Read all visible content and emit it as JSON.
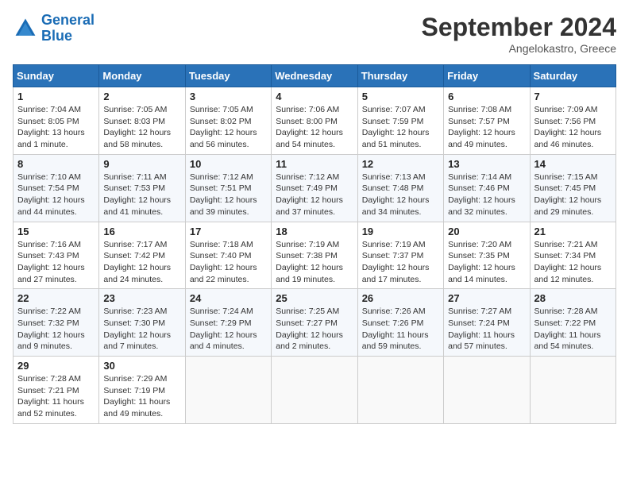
{
  "header": {
    "logo_line1": "General",
    "logo_line2": "Blue",
    "month": "September 2024",
    "location": "Angelokastro, Greece"
  },
  "days_of_week": [
    "Sunday",
    "Monday",
    "Tuesday",
    "Wednesday",
    "Thursday",
    "Friday",
    "Saturday"
  ],
  "weeks": [
    [
      {
        "day": "1",
        "info": "Sunrise: 7:04 AM\nSunset: 8:05 PM\nDaylight: 13 hours\nand 1 minute."
      },
      {
        "day": "2",
        "info": "Sunrise: 7:05 AM\nSunset: 8:03 PM\nDaylight: 12 hours\nand 58 minutes."
      },
      {
        "day": "3",
        "info": "Sunrise: 7:05 AM\nSunset: 8:02 PM\nDaylight: 12 hours\nand 56 minutes."
      },
      {
        "day": "4",
        "info": "Sunrise: 7:06 AM\nSunset: 8:00 PM\nDaylight: 12 hours\nand 54 minutes."
      },
      {
        "day": "5",
        "info": "Sunrise: 7:07 AM\nSunset: 7:59 PM\nDaylight: 12 hours\nand 51 minutes."
      },
      {
        "day": "6",
        "info": "Sunrise: 7:08 AM\nSunset: 7:57 PM\nDaylight: 12 hours\nand 49 minutes."
      },
      {
        "day": "7",
        "info": "Sunrise: 7:09 AM\nSunset: 7:56 PM\nDaylight: 12 hours\nand 46 minutes."
      }
    ],
    [
      {
        "day": "8",
        "info": "Sunrise: 7:10 AM\nSunset: 7:54 PM\nDaylight: 12 hours\nand 44 minutes."
      },
      {
        "day": "9",
        "info": "Sunrise: 7:11 AM\nSunset: 7:53 PM\nDaylight: 12 hours\nand 41 minutes."
      },
      {
        "day": "10",
        "info": "Sunrise: 7:12 AM\nSunset: 7:51 PM\nDaylight: 12 hours\nand 39 minutes."
      },
      {
        "day": "11",
        "info": "Sunrise: 7:12 AM\nSunset: 7:49 PM\nDaylight: 12 hours\nand 37 minutes."
      },
      {
        "day": "12",
        "info": "Sunrise: 7:13 AM\nSunset: 7:48 PM\nDaylight: 12 hours\nand 34 minutes."
      },
      {
        "day": "13",
        "info": "Sunrise: 7:14 AM\nSunset: 7:46 PM\nDaylight: 12 hours\nand 32 minutes."
      },
      {
        "day": "14",
        "info": "Sunrise: 7:15 AM\nSunset: 7:45 PM\nDaylight: 12 hours\nand 29 minutes."
      }
    ],
    [
      {
        "day": "15",
        "info": "Sunrise: 7:16 AM\nSunset: 7:43 PM\nDaylight: 12 hours\nand 27 minutes."
      },
      {
        "day": "16",
        "info": "Sunrise: 7:17 AM\nSunset: 7:42 PM\nDaylight: 12 hours\nand 24 minutes."
      },
      {
        "day": "17",
        "info": "Sunrise: 7:18 AM\nSunset: 7:40 PM\nDaylight: 12 hours\nand 22 minutes."
      },
      {
        "day": "18",
        "info": "Sunrise: 7:19 AM\nSunset: 7:38 PM\nDaylight: 12 hours\nand 19 minutes."
      },
      {
        "day": "19",
        "info": "Sunrise: 7:19 AM\nSunset: 7:37 PM\nDaylight: 12 hours\nand 17 minutes."
      },
      {
        "day": "20",
        "info": "Sunrise: 7:20 AM\nSunset: 7:35 PM\nDaylight: 12 hours\nand 14 minutes."
      },
      {
        "day": "21",
        "info": "Sunrise: 7:21 AM\nSunset: 7:34 PM\nDaylight: 12 hours\nand 12 minutes."
      }
    ],
    [
      {
        "day": "22",
        "info": "Sunrise: 7:22 AM\nSunset: 7:32 PM\nDaylight: 12 hours\nand 9 minutes."
      },
      {
        "day": "23",
        "info": "Sunrise: 7:23 AM\nSunset: 7:30 PM\nDaylight: 12 hours\nand 7 minutes."
      },
      {
        "day": "24",
        "info": "Sunrise: 7:24 AM\nSunset: 7:29 PM\nDaylight: 12 hours\nand 4 minutes."
      },
      {
        "day": "25",
        "info": "Sunrise: 7:25 AM\nSunset: 7:27 PM\nDaylight: 12 hours\nand 2 minutes."
      },
      {
        "day": "26",
        "info": "Sunrise: 7:26 AM\nSunset: 7:26 PM\nDaylight: 11 hours\nand 59 minutes."
      },
      {
        "day": "27",
        "info": "Sunrise: 7:27 AM\nSunset: 7:24 PM\nDaylight: 11 hours\nand 57 minutes."
      },
      {
        "day": "28",
        "info": "Sunrise: 7:28 AM\nSunset: 7:22 PM\nDaylight: 11 hours\nand 54 minutes."
      }
    ],
    [
      {
        "day": "29",
        "info": "Sunrise: 7:28 AM\nSunset: 7:21 PM\nDaylight: 11 hours\nand 52 minutes."
      },
      {
        "day": "30",
        "info": "Sunrise: 7:29 AM\nSunset: 7:19 PM\nDaylight: 11 hours\nand 49 minutes."
      },
      {
        "day": "",
        "info": ""
      },
      {
        "day": "",
        "info": ""
      },
      {
        "day": "",
        "info": ""
      },
      {
        "day": "",
        "info": ""
      },
      {
        "day": "",
        "info": ""
      }
    ]
  ]
}
